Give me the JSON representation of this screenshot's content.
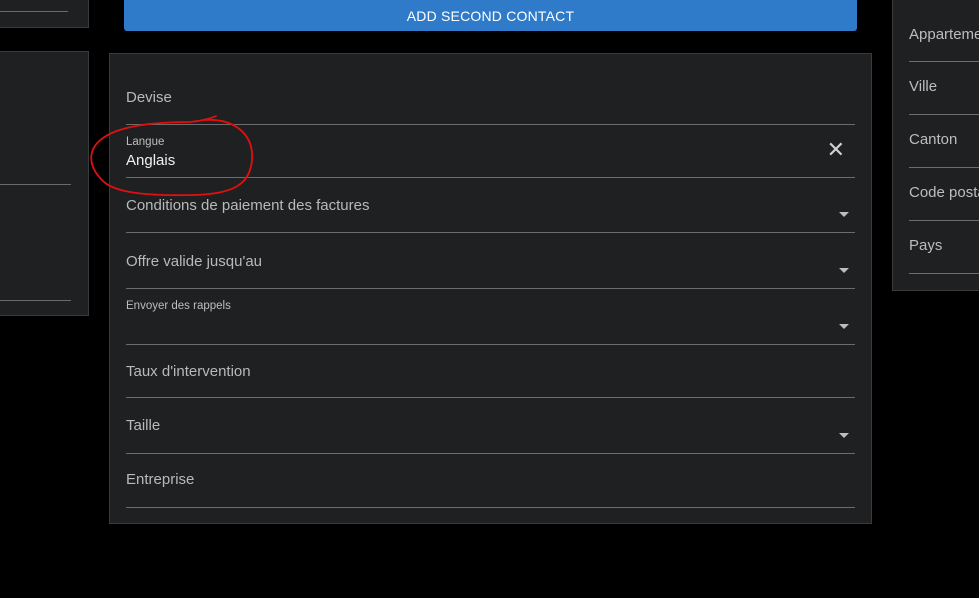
{
  "add_contact_button": "ADD SECOND CONTACT",
  "form": {
    "devise_placeholder": "Devise",
    "langue_label": "Langue",
    "langue_value": "Anglais",
    "conditions_placeholder": "Conditions de paiement des factures",
    "offre_placeholder": "Offre valide jusqu'au",
    "rappels_label": "Envoyer des rappels",
    "taux_placeholder": "Taux  d'intervention",
    "taille_placeholder": "Taille",
    "entreprise_placeholder": "Entreprise"
  },
  "address": {
    "items": [
      "Appartement",
      "Ville",
      "Canton",
      "Code postal",
      "Pays"
    ]
  },
  "colors": {
    "background": "#000000",
    "panel": "#1f2022",
    "button": "#2f7bc9",
    "annotation": "#e01010"
  },
  "icons": {
    "clear": "close-icon",
    "dropdown": "chevron-down-icon"
  }
}
